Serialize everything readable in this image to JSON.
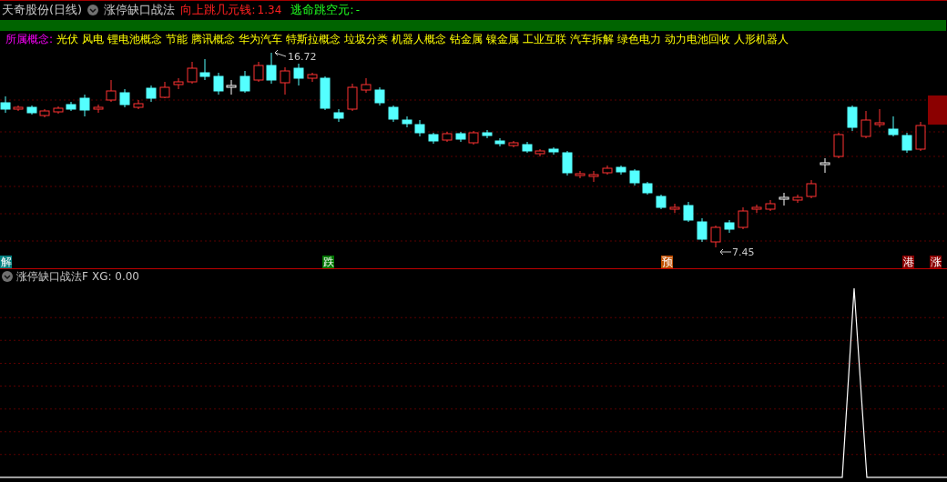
{
  "header": {
    "stock": "天奇股份(日线)",
    "indicator": "涨停缺口战法",
    "gap_up_label": "向上跳几元钱:",
    "gap_up_value": "1.34",
    "escape_label": "逃命跳空元:",
    "escape_value": "-"
  },
  "concepts": {
    "label": "所属概念:",
    "items": [
      "光伏",
      "风电",
      "锂电池概念",
      "节能",
      "腾讯概念",
      "华为汽车",
      "特斯拉概念",
      "垃圾分类",
      "机器人概念",
      "钴金属",
      "镍金属",
      "工业互联",
      "汽车拆解",
      "绿色电力",
      "动力电池回收",
      "人形机器人"
    ]
  },
  "price_chart": {
    "high_label": "16.72",
    "low_label": "7.45"
  },
  "signals": [
    {
      "text": "解",
      "color": "#008080"
    },
    {
      "text": "跌",
      "color": "#007700"
    },
    {
      "text": "预",
      "color": "#c05000"
    },
    {
      "text": "港",
      "color": "#8b0000"
    },
    {
      "text": "涨",
      "color": "#8b0000"
    }
  ],
  "sub_panel": {
    "title": "涨停缺口战法F",
    "reading": "XG: 0.00"
  }
}
